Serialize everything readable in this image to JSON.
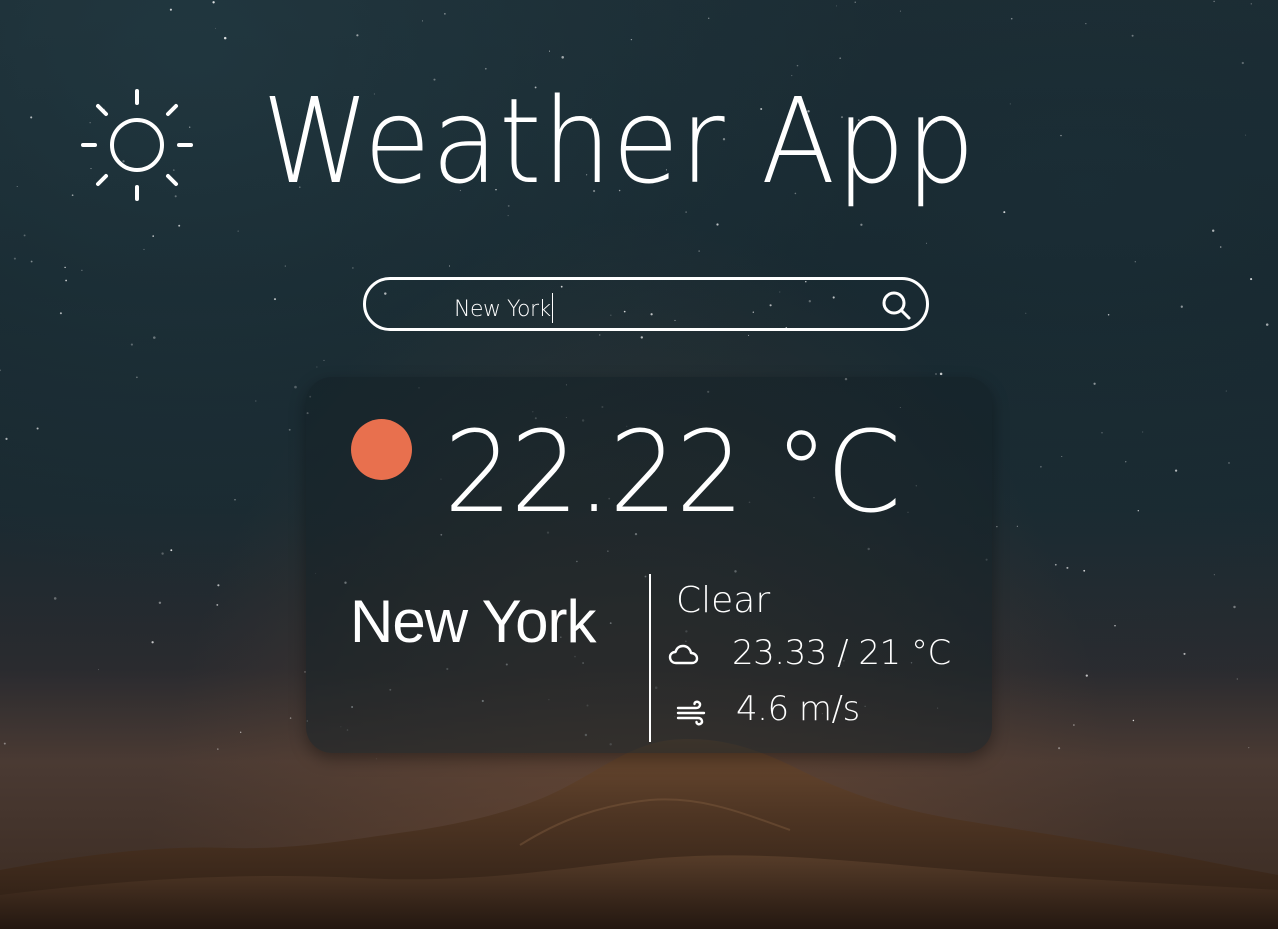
{
  "app": {
    "title": "Weather App",
    "logo_icon": "sun-icon"
  },
  "search": {
    "value": "New York",
    "icon": "search-icon"
  },
  "weather": {
    "temperature": "22.22 °C",
    "city": "New York",
    "condition": "Clear",
    "temp_range": "23.33 / 21 °C",
    "temp_range_icon": "cloud-icon",
    "wind": "4.6 m/s",
    "wind_icon": "wind-icon",
    "status_color": "#e8704e"
  },
  "colors": {
    "text": "#ffffff",
    "accent": "#e8704e",
    "background_top": "#1b2a31",
    "background_bottom": "#3a2a20"
  }
}
